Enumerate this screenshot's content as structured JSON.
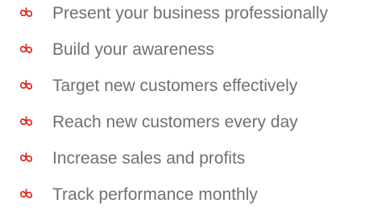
{
  "benefits": {
    "bullet_icon": "swirl-bullet-icon",
    "accent_color": "#e32219",
    "text_color": "#707070",
    "items": [
      {
        "label": "Present your business professionally"
      },
      {
        "label": "Build your awareness"
      },
      {
        "label": "Target new customers effectively"
      },
      {
        "label": "Reach new customers every day"
      },
      {
        "label": "Increase sales and profits"
      },
      {
        "label": "Track performance monthly"
      }
    ]
  }
}
